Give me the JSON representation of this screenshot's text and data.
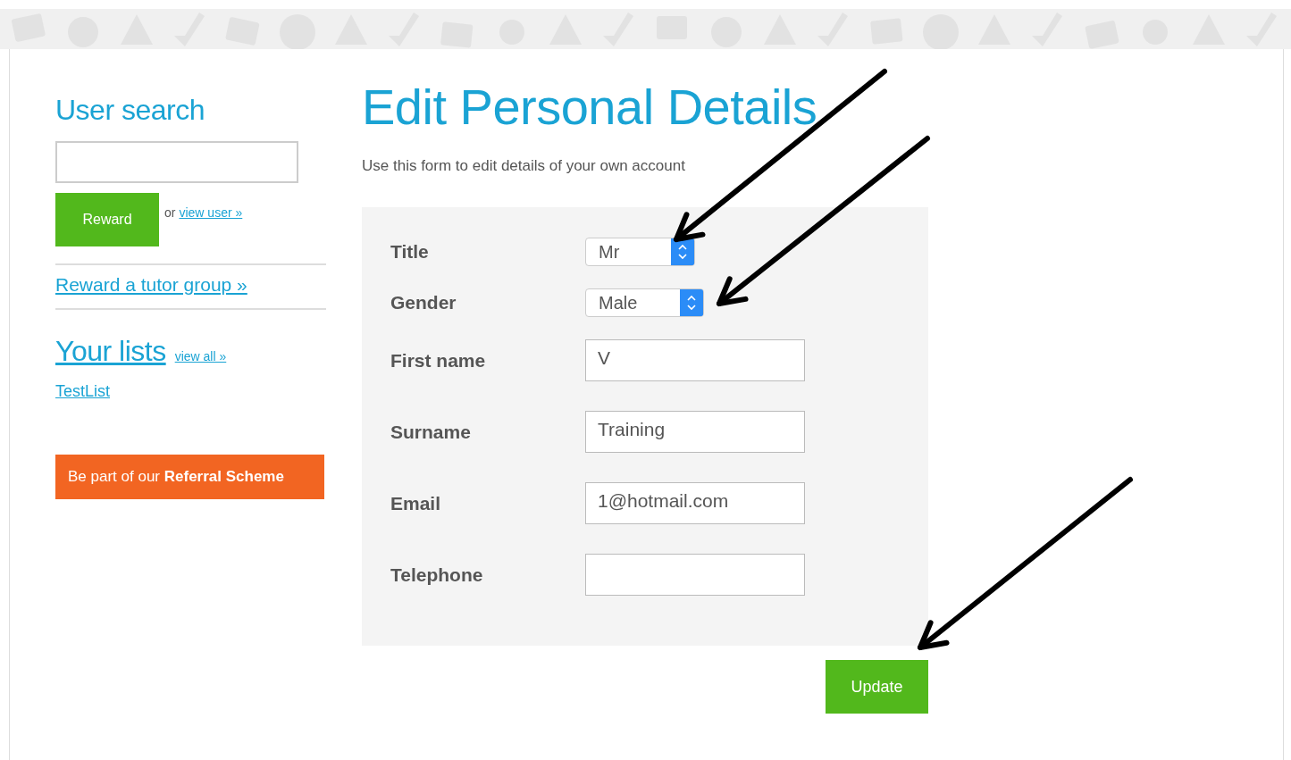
{
  "sidebar": {
    "search_heading": "User search",
    "reward_button": "Reward",
    "or_text": "or",
    "view_user_link": "view user »",
    "tutor_group_link": "Reward a tutor group »",
    "lists_heading": "Your lists",
    "view_all_link": "view all »",
    "lists": [
      "TestList"
    ],
    "referral_button": "Be part of our **Referral Scheme**"
  },
  "page_title": "Edit Personal Details",
  "intro": "Use this form to edit details of your own account",
  "form": {
    "fields": [
      {
        "label": "Title",
        "kind": "select",
        "value": "Mr"
      },
      {
        "label": "Gender",
        "kind": "select",
        "value": "Male"
      },
      {
        "label": "First name",
        "kind": "text",
        "value": "V"
      },
      {
        "label": "Surname",
        "kind": "text",
        "value": "Training"
      },
      {
        "label": "Email",
        "kind": "text",
        "value": "1@hotmail.com"
      },
      {
        "label": "Telephone",
        "kind": "text"
      }
    ]
  },
  "update_button": "Update"
}
